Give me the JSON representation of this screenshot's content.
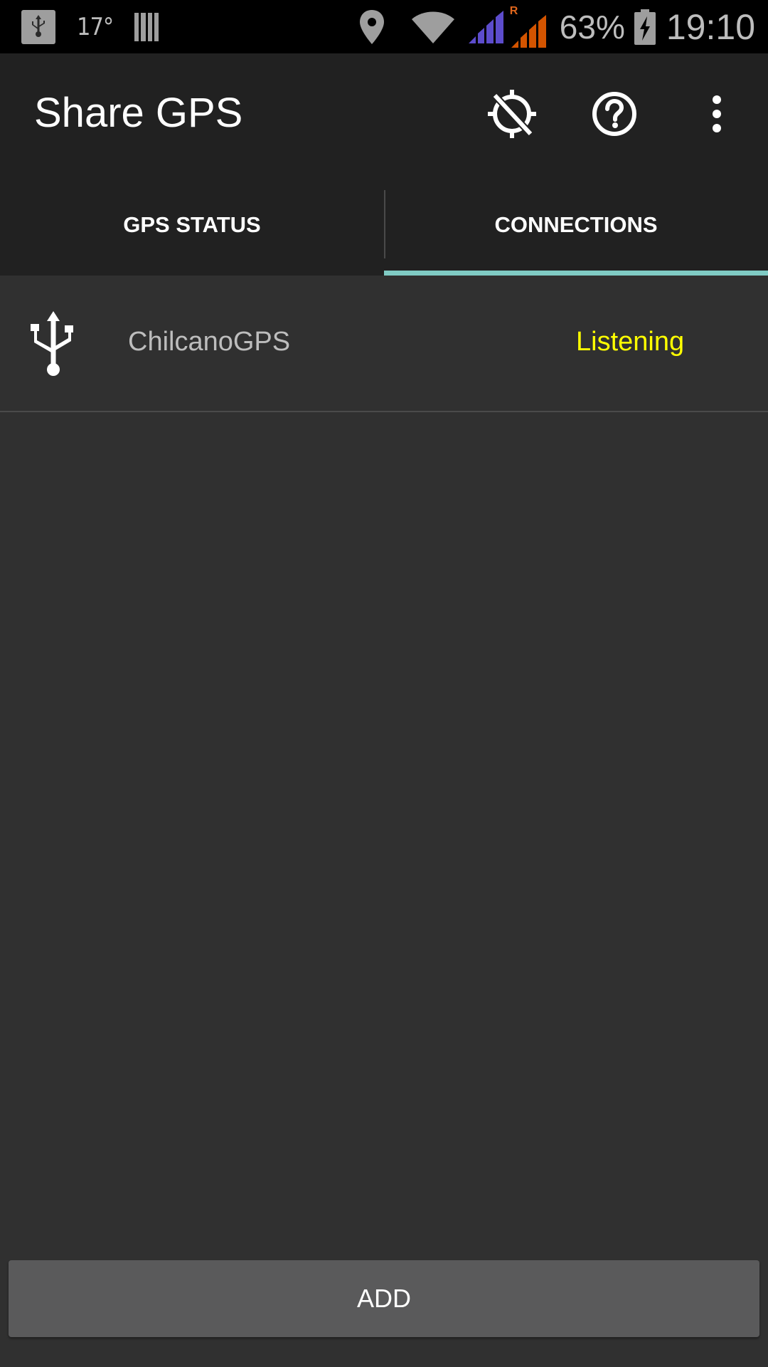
{
  "status_bar": {
    "temperature": "17°",
    "battery_percent": "63%",
    "time": "19:10",
    "roaming_indicator": "R",
    "icons": [
      "usb-icon",
      "sim-icon",
      "location-icon",
      "wifi-icon",
      "signal-icon",
      "signal-roaming-icon",
      "battery-charging-icon"
    ]
  },
  "action_bar": {
    "title": "Share GPS",
    "icons": [
      "gps-off-icon",
      "help-icon",
      "more-vert-icon"
    ]
  },
  "tabs": [
    {
      "label": "GPS STATUS",
      "selected": false
    },
    {
      "label": "CONNECTIONS",
      "selected": true
    }
  ],
  "connections": [
    {
      "icon": "usb-icon",
      "name": "ChilcanoGPS",
      "status": "Listening",
      "status_color": "#ffff00"
    }
  ],
  "add_button": {
    "label": "ADD"
  },
  "colors": {
    "tab_indicator": "#80cbc4",
    "toolbar_bg": "#212121",
    "content_bg": "#303030",
    "status_listening": "#ffff00"
  }
}
